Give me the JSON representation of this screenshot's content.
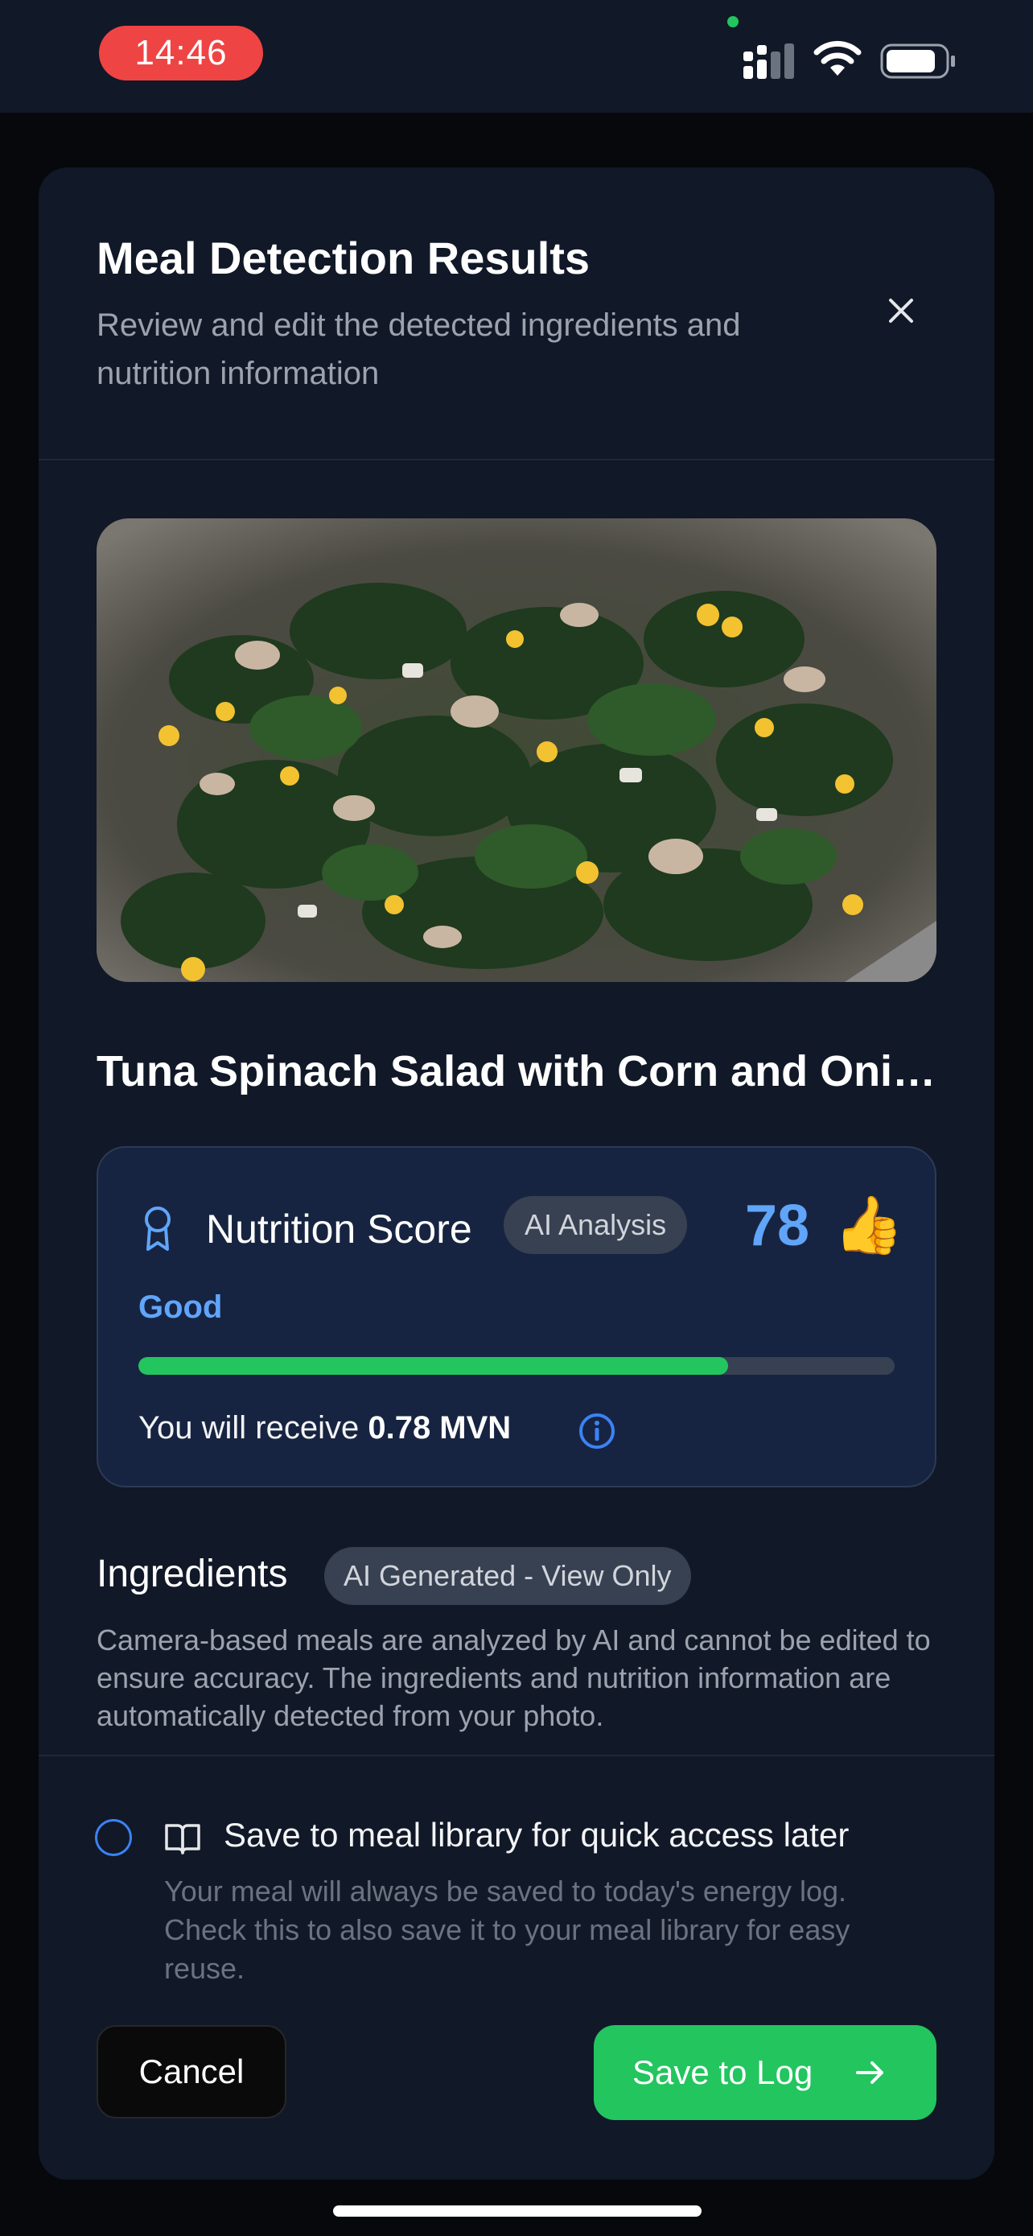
{
  "status_bar": {
    "time": "14:46",
    "icons": [
      "cellular-signal-icon",
      "wifi-icon",
      "battery-icon"
    ],
    "time_pill_color": "#ef4444"
  },
  "modal": {
    "title": "Meal Detection Results",
    "subtitle": "Review and edit the detected ingredients and nutrition information",
    "close_icon": "close-icon"
  },
  "meal": {
    "photo_alt": "meal-photo",
    "name": "Tuna Spinach Salad with Corn and Onion"
  },
  "nutrition": {
    "label": "Nutrition Score",
    "badge": "AI Analysis",
    "score": "78",
    "emoji": "👍",
    "rating": "Good",
    "progress_fraction": 0.78,
    "reward_prefix": "You will receive ",
    "reward_amount": "0.78 MVN",
    "accent_color": "#60a5fa",
    "progress_color": "#22c55e"
  },
  "ingredients": {
    "title": "Ingredients",
    "badge": "AI Generated - View Only",
    "description": "Camera-based meals are analyzed by AI and cannot be edited to ensure accuracy. The ingredients and nutrition information are automatically detected from your photo."
  },
  "library": {
    "checked": false,
    "label": "Save to meal library for quick access later",
    "description": "Your meal will always be saved to today's energy log. Check this to also save it to your meal library for easy reuse."
  },
  "actions": {
    "cancel_label": "Cancel",
    "save_label": "Save to Log"
  }
}
